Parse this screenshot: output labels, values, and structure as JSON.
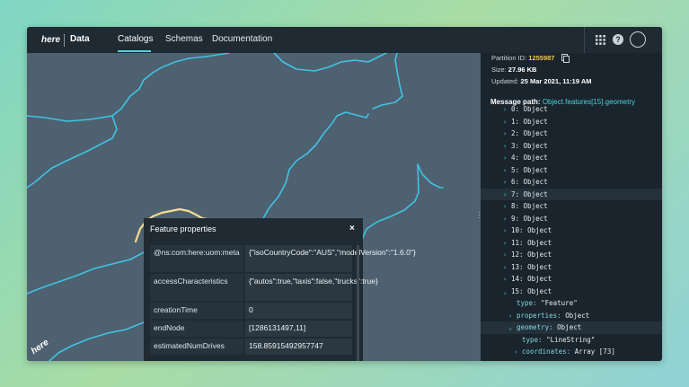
{
  "nav": {
    "logo": "here",
    "app_name": "Data",
    "items": [
      "Catalogs",
      "Schemas",
      "Documentation"
    ],
    "active": "Catalogs"
  },
  "map": {
    "logo": "here"
  },
  "popup": {
    "title": "Feature properties",
    "close": "×",
    "rows": [
      {
        "key": "@ns:com:here:uom:meta",
        "value": "{\"isoCountryCode\":\"AUS\",\"modelVersion\":\"1.6.0\"}"
      },
      {
        "key": "accessCharacteristics",
        "value": "{\"autos\":true,\"taxis\":false,\"trucks\":true}"
      },
      {
        "key": "creationTime",
        "value": "0"
      },
      {
        "key": "endNode",
        "value": "[1286131497,11]"
      },
      {
        "key": "estimatedNumDrives",
        "value": "158.85915492957747"
      }
    ]
  },
  "panel": {
    "partition_label": "Partition ID:",
    "partition_id": "1255987",
    "size_label": "Size:",
    "size": "27.96 KB",
    "updated_label": "Updated:",
    "updated": "25 Mar 2021, 11:19 AM",
    "message_path_label": "Message path:",
    "message_path": "Object.features[15].geometry",
    "tree": [
      {
        "indent": 0,
        "chev": "›",
        "key": "0:",
        "val": "Object"
      },
      {
        "indent": 0,
        "chev": "›",
        "key": "1:",
        "val": "Object"
      },
      {
        "indent": 0,
        "chev": "›",
        "key": "2:",
        "val": "Object"
      },
      {
        "indent": 0,
        "chev": "›",
        "key": "3:",
        "val": "Object"
      },
      {
        "indent": 0,
        "chev": "›",
        "key": "4:",
        "val": "Object"
      },
      {
        "indent": 0,
        "chev": "›",
        "key": "5:",
        "val": "Object"
      },
      {
        "indent": 0,
        "chev": "›",
        "key": "6:",
        "val": "Object"
      },
      {
        "indent": 0,
        "chev": "›",
        "key": "7:",
        "val": "Object"
      },
      {
        "indent": 0,
        "chev": "›",
        "key": "8:",
        "val": "Object"
      },
      {
        "indent": 0,
        "chev": "›",
        "key": "9:",
        "val": "Object"
      },
      {
        "indent": 0,
        "chev": "›",
        "key": "10:",
        "val": "Object"
      },
      {
        "indent": 0,
        "chev": "›",
        "key": "11:",
        "val": "Object"
      },
      {
        "indent": 0,
        "chev": "›",
        "key": "12:",
        "val": "Object"
      },
      {
        "indent": 0,
        "chev": "›",
        "key": "13:",
        "val": "Object"
      },
      {
        "indent": 0,
        "chev": "›",
        "key": "14:",
        "val": "Object"
      },
      {
        "indent": 0,
        "chev": "⌄",
        "key": "15:",
        "val": "Object"
      },
      {
        "indent": 1,
        "chev": "",
        "key": "type:",
        "val": "\"Feature\""
      },
      {
        "indent": 1,
        "chev": "›",
        "key": "properties:",
        "val": "Object"
      },
      {
        "indent": 1,
        "chev": "⌄",
        "key": "geometry:",
        "val": "Object"
      },
      {
        "indent": 2,
        "chev": "",
        "key": "type:",
        "val": "\"LineString\""
      },
      {
        "indent": 2,
        "chev": "›",
        "key": "coordinates:",
        "val": "Array [73]"
      }
    ]
  },
  "colors": {
    "accent": "#4fd1e0",
    "road": "#3fc3e3",
    "highlight_road": "#f5dc8f",
    "partition_id": "#f3c64a"
  }
}
